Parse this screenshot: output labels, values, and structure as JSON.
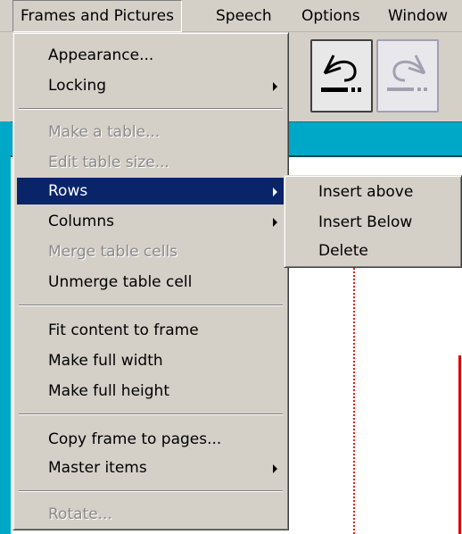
{
  "menubar": {
    "items": [
      {
        "label": "Frames and Pictures",
        "active": true
      },
      {
        "label": "Speech"
      },
      {
        "label": "Options"
      },
      {
        "label": "Window"
      }
    ]
  },
  "toolbar": {
    "undo_icon": "undo-icon",
    "redo_icon": "redo-icon"
  },
  "menu": {
    "items": [
      {
        "label": "Appearance...",
        "enabled": true
      },
      {
        "label": "Locking",
        "enabled": true,
        "submenu": true
      },
      {
        "label": "Make a table...",
        "enabled": false
      },
      {
        "label": "Edit table size...",
        "enabled": false
      },
      {
        "label": "Rows",
        "enabled": true,
        "submenu": true,
        "selected": true
      },
      {
        "label": "Columns",
        "enabled": true,
        "submenu": true
      },
      {
        "label": "Merge table cells",
        "enabled": false
      },
      {
        "label": "Unmerge table cell",
        "enabled": true
      },
      {
        "label": "Fit content to frame",
        "enabled": true
      },
      {
        "label": "Make full width",
        "enabled": true
      },
      {
        "label": "Make full height",
        "enabled": true
      },
      {
        "label": "Copy frame to pages...",
        "enabled": true
      },
      {
        "label": "Master items",
        "enabled": true,
        "submenu": true
      },
      {
        "label": "Rotate...",
        "enabled": false
      }
    ]
  },
  "submenu": {
    "items": [
      {
        "label": "Insert above"
      },
      {
        "label": "Insert Below"
      },
      {
        "label": "Delete"
      }
    ]
  },
  "colors": {
    "menu_bg": "#d4d0c8",
    "highlight": "#0a246a",
    "accent_cyan": "#00a8c8",
    "guide_red": "#e00000"
  }
}
